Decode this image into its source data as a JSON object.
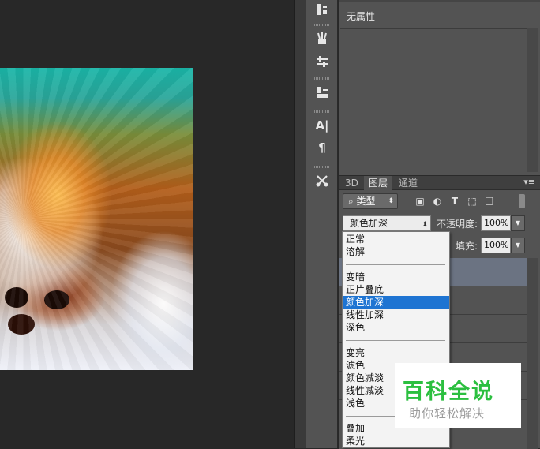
{
  "properties_panel": {
    "title": "无属性"
  },
  "layers_panel": {
    "tabs": [
      {
        "label": "3D",
        "active": false
      },
      {
        "label": "图层",
        "active": true
      },
      {
        "label": "通道",
        "active": false
      }
    ],
    "filter_kind": "类型",
    "blend_mode": "颜色加深",
    "opacity_label": "不透明度:",
    "opacity_value": "100%",
    "fill_label": "填充:",
    "fill_value": "100%"
  },
  "blend_dropdown": {
    "groups": [
      [
        "正常",
        "溶解"
      ],
      [
        "变暗",
        "正片叠底",
        "颜色加深",
        "线性加深",
        "深色"
      ],
      [
        "变亮",
        "滤色",
        "颜色减淡",
        "线性减淡",
        "浅色"
      ],
      [
        "叠加",
        "柔光"
      ]
    ],
    "selected": "颜色加深"
  },
  "watermark": {
    "title": "百科全说",
    "subtitle": "助你轻松解决"
  },
  "colors": {
    "accent_highlight": "#1e74d2",
    "watermark_green": "#2bbf3f",
    "panel_bg": "#535353"
  }
}
